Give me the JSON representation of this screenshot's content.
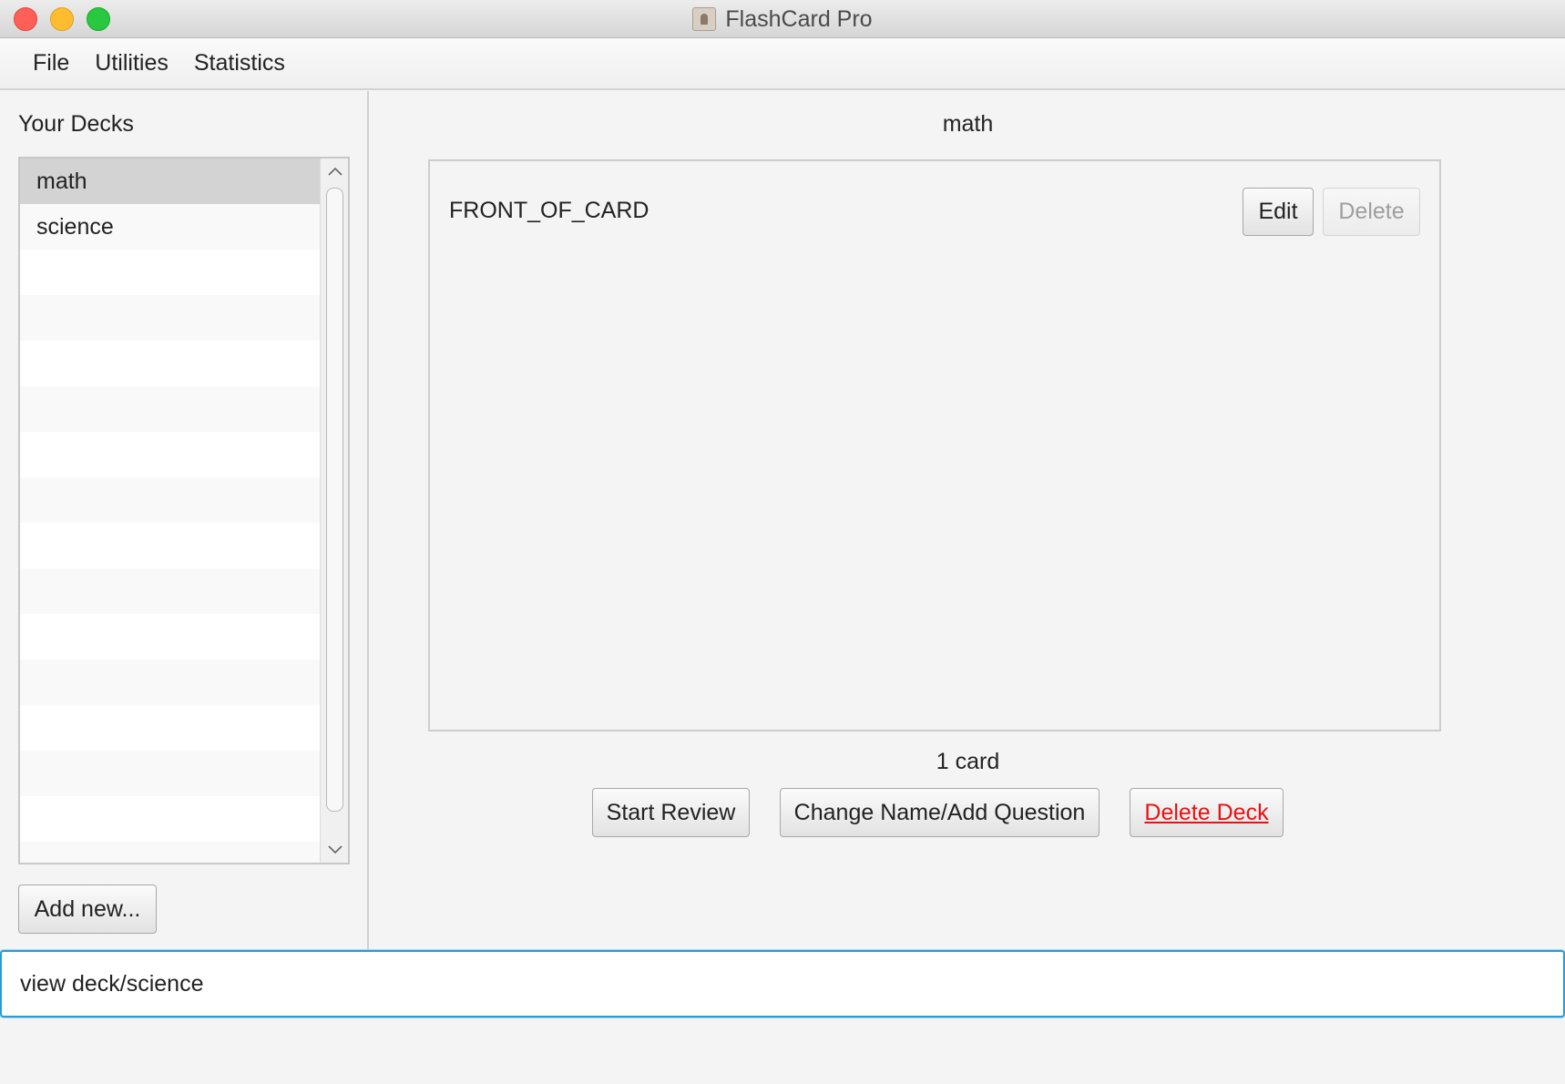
{
  "window": {
    "title": "FlashCard Pro",
    "app_icon": "contact-book-icon"
  },
  "menubar": {
    "items": [
      "File",
      "Utilities",
      "Statistics"
    ]
  },
  "sidebar": {
    "heading": "Your Decks",
    "decks": [
      "math",
      "science"
    ],
    "selected_index": 0,
    "add_button_label": "Add new...",
    "scroll_up_icon": "chevron-up-icon",
    "scroll_down_icon": "chevron-down-icon"
  },
  "main": {
    "deck_title": "math",
    "cards": [
      {
        "front": "FRONT_OF_CARD",
        "edit_label": "Edit",
        "delete_label": "Delete"
      }
    ],
    "card_count": "1 card",
    "buttons": {
      "start_review": "Start Review",
      "change_name": "Change Name/Add Question",
      "delete_deck": "Delete Deck"
    }
  },
  "command": {
    "value": "view deck/science"
  },
  "colors": {
    "accent": "#2c9ad6",
    "danger": "#e81212",
    "selected_row": "#d3d3d3"
  }
}
